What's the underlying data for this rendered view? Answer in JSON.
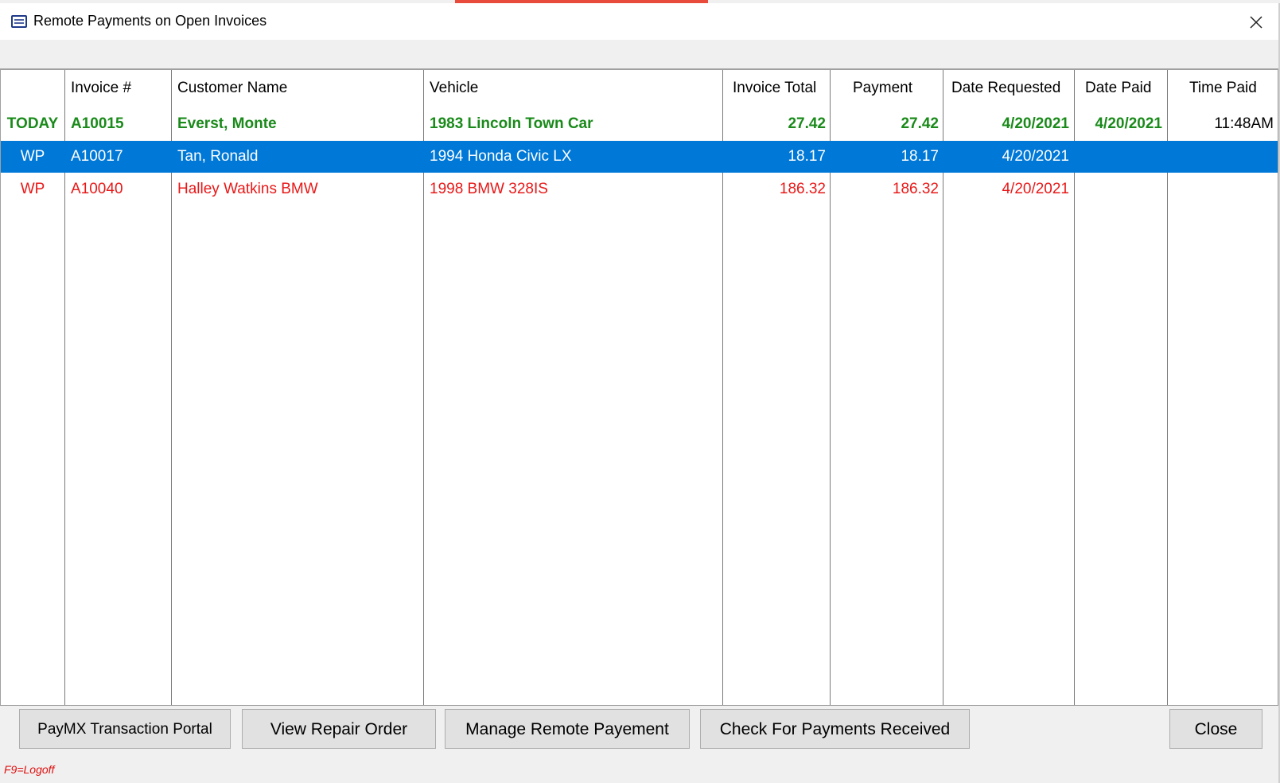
{
  "window": {
    "title": "Remote Payments on Open Invoices"
  },
  "colors": {
    "today_row": "#1a8a1a",
    "wp_red": "#e81818",
    "selected_bg": "#0078d7"
  },
  "columns": [
    {
      "key": "status",
      "label": ""
    },
    {
      "key": "invoice",
      "label": "Invoice #"
    },
    {
      "key": "customer",
      "label": "Customer Name"
    },
    {
      "key": "vehicle",
      "label": "Vehicle"
    },
    {
      "key": "invoice_total",
      "label": "Invoice Total"
    },
    {
      "key": "payment",
      "label": "Payment"
    },
    {
      "key": "date_requested",
      "label": "Date Requested"
    },
    {
      "key": "date_paid",
      "label": "Date Paid"
    },
    {
      "key": "time_paid",
      "label": "Time Paid"
    }
  ],
  "rows": [
    {
      "status": "TODAY",
      "invoice": "A10015",
      "customer": "Everst, Monte",
      "vehicle": "1983 Lincoln  Town Car",
      "invoice_total": "27.42",
      "payment": "27.42",
      "date_requested": "4/20/2021",
      "date_paid": "4/20/2021",
      "time_paid": "11:48AM"
    },
    {
      "status": "WP",
      "invoice": "A10017",
      "customer": "Tan, Ronald",
      "vehicle": "1994 Honda  Civic LX",
      "invoice_total": "18.17",
      "payment": "18.17",
      "date_requested": "4/20/2021",
      "date_paid": "",
      "time_paid": ""
    },
    {
      "status": "WP",
      "invoice": "A10040",
      "customer": "Halley Watkins BMW",
      "vehicle": "1998 BMW  328IS",
      "invoice_total": "186.32",
      "payment": "186.32",
      "date_requested": "4/20/2021",
      "date_paid": "",
      "time_paid": ""
    }
  ],
  "buttons": {
    "paymx": "PayMX Transaction Portal",
    "view_repair": "View Repair Order",
    "manage_remote": "Manage Remote Payement",
    "check_payments": "Check For Payments Received",
    "close": "Close"
  },
  "status_bar": {
    "hint": "F9=Logoff"
  }
}
